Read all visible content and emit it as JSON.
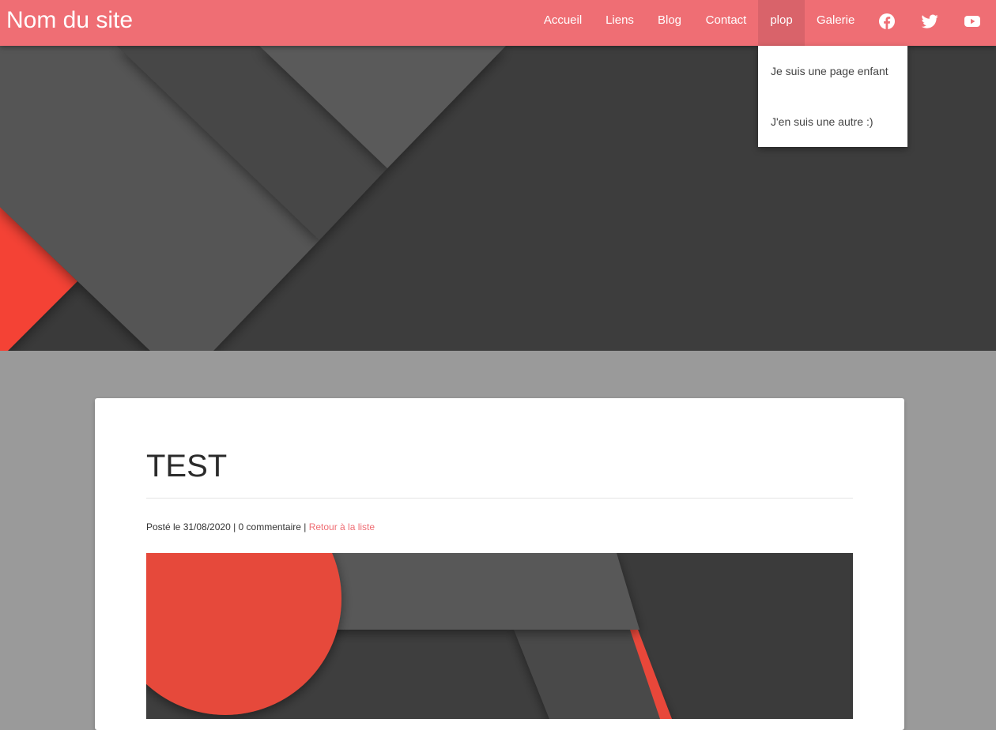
{
  "site": {
    "name": "Nom du site"
  },
  "nav": {
    "items": [
      {
        "label": "Accueil"
      },
      {
        "label": "Liens"
      },
      {
        "label": "Blog"
      },
      {
        "label": "Contact"
      },
      {
        "label": "plop"
      },
      {
        "label": "Galerie"
      }
    ],
    "social": [
      {
        "icon": "facebook-icon"
      },
      {
        "icon": "twitter-icon"
      },
      {
        "icon": "youtube-icon"
      }
    ],
    "dropdown": {
      "items": [
        {
          "label": "Je suis une page enfant"
        },
        {
          "label": "J'en suis une autre :)"
        }
      ]
    }
  },
  "post": {
    "title": "TEST",
    "meta_prefix": "Posté le 31/08/2020 | 0 commentaire | ",
    "back_link": "Retour à la liste"
  },
  "colors": {
    "accent": "#ef6e74",
    "nav_active": "#d9636a",
    "page_background": "#9a9a9a",
    "hero_dark": "#3d3d3d",
    "hero_red": "#f44336"
  }
}
